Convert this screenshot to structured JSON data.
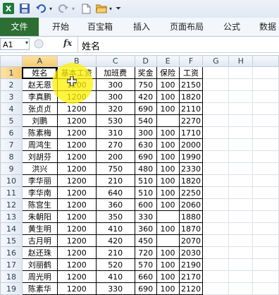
{
  "ribbon": {
    "file_label": "文件",
    "tabs": [
      "开始",
      "百宝箱",
      "插入",
      "页面布局",
      "公式",
      "数据"
    ]
  },
  "formula_bar": {
    "name_box": "A1",
    "fx_label": "fx",
    "content": "姓名"
  },
  "sheet": {
    "columns": [
      "A",
      "B",
      "C",
      "D",
      "E",
      "F",
      "G",
      "H"
    ],
    "row_numbers": [
      "1",
      "2",
      "3",
      "4",
      "5",
      "6",
      "7",
      "8",
      "9",
      "10",
      "11",
      "12",
      "13",
      "14",
      "15",
      "16",
      "17",
      "18",
      "19"
    ],
    "headers": [
      "姓名",
      "基本工资",
      "加班费",
      "奖金",
      "保险",
      "工资"
    ],
    "rows": [
      [
        "赵无恩",
        "1200",
        "300",
        "750",
        "100",
        "2150"
      ],
      [
        "李真鹏",
        "1200",
        "300",
        "420",
        "100",
        "1820"
      ],
      [
        "张贞贞",
        "1200",
        "320",
        "690",
        "100",
        "2110"
      ],
      [
        "刘鹏",
        "1200",
        "530",
        "540",
        "",
        "2270"
      ],
      [
        "陈素梅",
        "1200",
        "310",
        "300",
        "100",
        "1710"
      ],
      [
        "周鸿生",
        "1200",
        "270",
        "630",
        "100",
        "2000"
      ],
      [
        "刘胡芬",
        "1200",
        "200",
        "690",
        "100",
        "1990"
      ],
      [
        "洪兴",
        "1200",
        "750",
        "480",
        "100",
        "2330"
      ],
      [
        "李华丽",
        "1200",
        "210",
        "510",
        "100",
        "1820"
      ],
      [
        "李华南",
        "1200",
        "640",
        "510",
        "100",
        "2250"
      ],
      [
        "陈宫生",
        "1200",
        "360",
        "600",
        "100",
        "2060"
      ],
      [
        "朱朝阳",
        "1200",
        "350",
        "330",
        "",
        "1880"
      ],
      [
        "黄生明",
        "1200",
        "410",
        "360",
        "100",
        "1870"
      ],
      [
        "古月明",
        "1200",
        "420",
        "450",
        "",
        "2070"
      ],
      [
        "赵还珠",
        "1200",
        "210",
        "720",
        "100",
        "2030"
      ],
      [
        "刘丽鹤",
        "1200",
        "520",
        "570",
        "100",
        "2190"
      ],
      [
        "周光明",
        "1200",
        "410",
        "660",
        "100",
        "2170"
      ],
      [
        "陈素华",
        "1200",
        "330",
        "690",
        "100",
        "2120"
      ]
    ]
  }
}
